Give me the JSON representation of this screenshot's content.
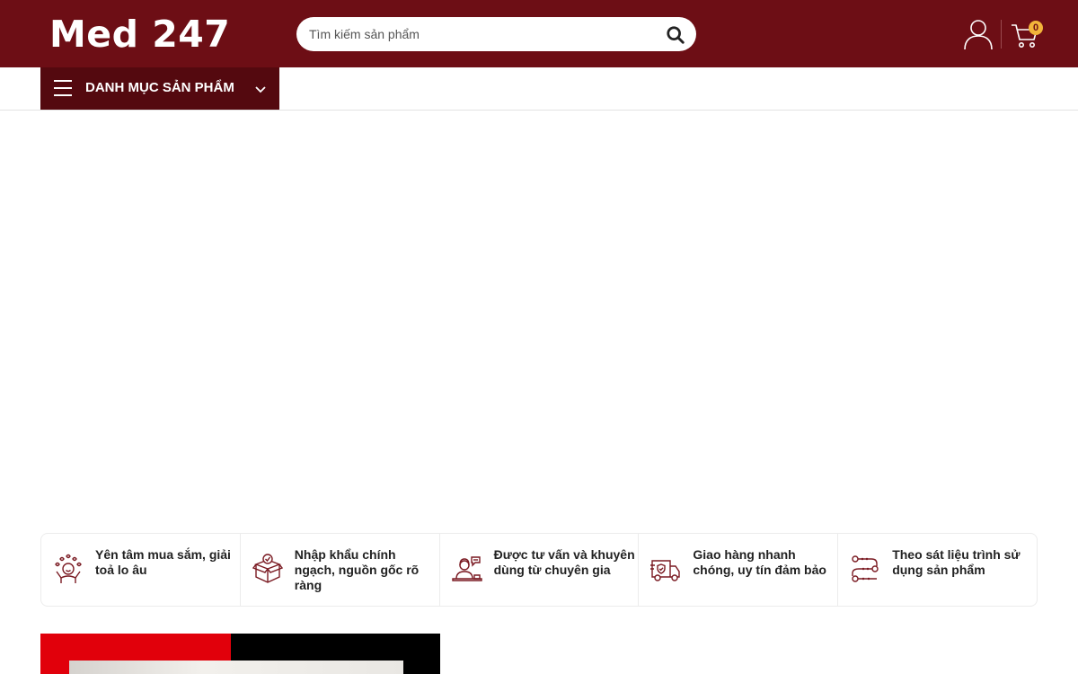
{
  "header": {
    "logo": "Med 247",
    "search": {
      "placeholder": "Tìm kiếm sản phẩm"
    },
    "cart_count": "0",
    "icons": {
      "search": "search-icon",
      "account": "user-icon",
      "cart": "cart-icon"
    }
  },
  "nav": {
    "category_label": "DANH MỤC SẢN PHẨM",
    "icons": {
      "menu": "hamburger-icon",
      "toggle": "chevron-down-icon"
    }
  },
  "features": [
    {
      "text": "Yên tâm mua sắm, giải toả lo âu",
      "icon": "happy-person-icon"
    },
    {
      "text": "Nhập khẩu chính ngạch, nguồn gốc rõ ràng",
      "icon": "verified-box-icon"
    },
    {
      "text": "Được tư vấn và khuyên dùng từ chuyên gia",
      "icon": "consultant-icon"
    },
    {
      "text": "Giao hàng nhanh chóng, uy tín đảm bảo",
      "icon": "delivery-truck-icon"
    },
    {
      "text": "Theo sát liệu trình sử dụng sản phẩm",
      "icon": "routine-path-icon"
    }
  ],
  "colors": {
    "header_bg": "#6d0e15",
    "category_bg": "#54090f",
    "badge_bg": "#f3b53a",
    "icon_stroke": "#7a1a22"
  }
}
